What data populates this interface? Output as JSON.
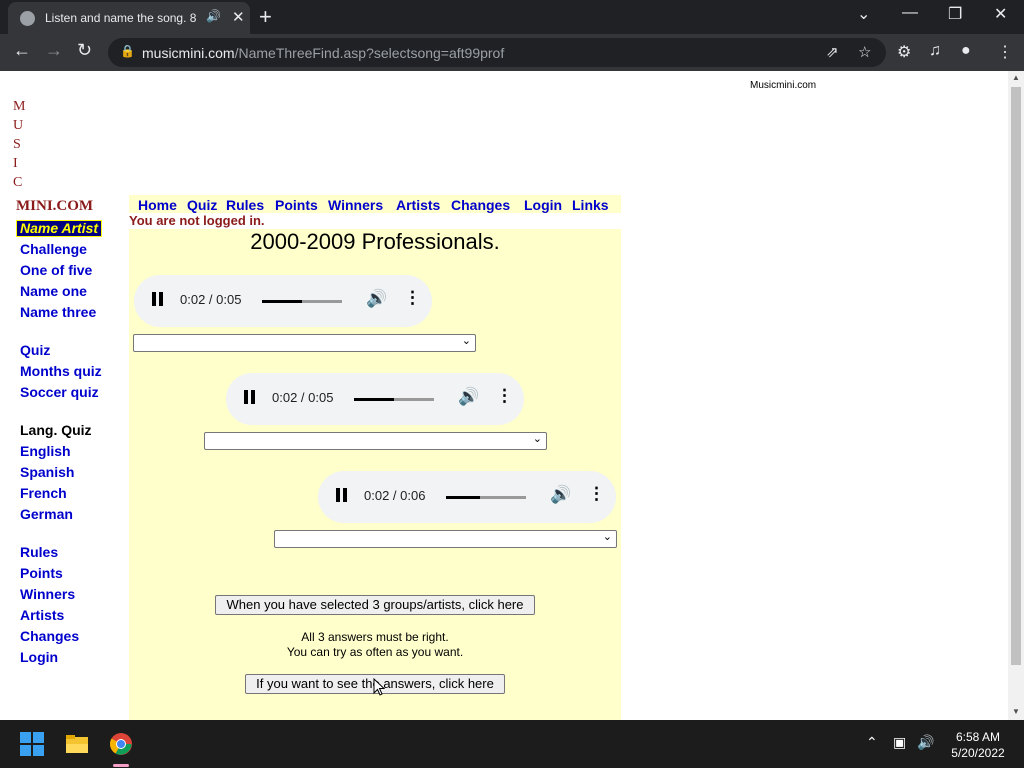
{
  "browser": {
    "tab_title": "Listen and name the song. 8",
    "url_domain": "musicmini.com",
    "url_path": "/NameThreeFind.asp?selectsong=aft99prof"
  },
  "page": {
    "site_name_top": "Musicmini.com",
    "logo_letters": [
      "M",
      "U",
      "S",
      "I",
      "C"
    ],
    "logo_mini": "MINI.COM",
    "side_nav": {
      "active_label": "Name Artist",
      "group1": [
        "Challenge",
        "One of five",
        "Name one",
        "Name three"
      ],
      "group2": [
        "Quiz",
        "Months quiz",
        "Soccer quiz"
      ],
      "lang_heading": "Lang. Quiz",
      "group3": [
        "English",
        "Spanish",
        "French",
        "German"
      ],
      "group4": [
        "Rules",
        "Points",
        "Winners",
        "Artists",
        "Changes",
        "Login"
      ]
    },
    "top_nav": [
      "Home",
      "Quiz",
      "Rules",
      "Points",
      "Winners",
      "Artists",
      "Changes",
      "Login",
      "Links"
    ],
    "login_status": "You are not logged in.",
    "title": "2000-2009 Professionals.",
    "players": [
      {
        "time": "0:02 / 0:05",
        "progress": 0.5
      },
      {
        "time": "0:02 / 0:05",
        "progress": 0.5
      },
      {
        "time": "0:02 / 0:06",
        "progress": 0.43
      }
    ],
    "submit_button": "When you have selected 3 groups/artists, click here",
    "note_line1": "All 3 answers must be right.",
    "note_line2": "You can try as often as you want.",
    "answers_button": "If you want to see the answers, click here"
  },
  "taskbar": {
    "time": "6:58 AM",
    "date": "5/20/2022"
  }
}
